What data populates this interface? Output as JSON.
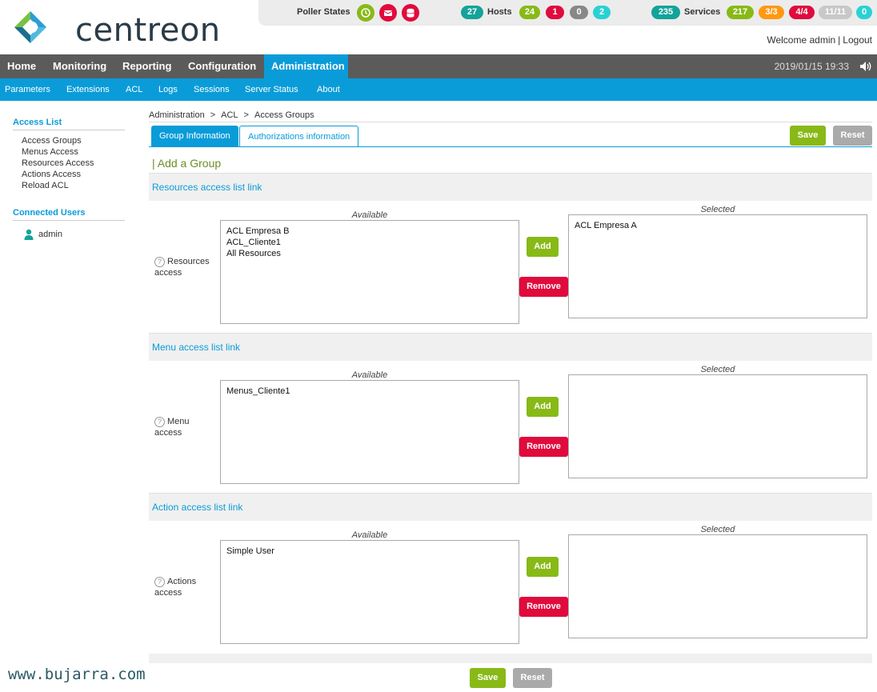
{
  "brand": {
    "name": "centreon"
  },
  "top": {
    "poller_states_label": "Poller States",
    "hosts_label": "Hosts",
    "hosts": [
      "27",
      "24",
      "1",
      "0",
      "2"
    ],
    "services_label": "Services",
    "services": [
      "235",
      "217",
      "3/3",
      "4/4",
      "11/11",
      "0"
    ],
    "welcome": "Welcome admin",
    "logout": "Logout",
    "colors": {
      "teal": "#13a39a",
      "green": "#88b917",
      "red": "#e00b3d",
      "gray": "#888888",
      "cyan": "#2ad1d4",
      "orange": "#ff9913",
      "lightgray": "#c8c8c8"
    }
  },
  "nav": {
    "items": [
      "Home",
      "Monitoring",
      "Reporting",
      "Configuration",
      "Administration"
    ],
    "active": "Administration",
    "datetime": "2019/01/15 19:33"
  },
  "subnav": {
    "items": [
      "Parameters",
      "Extensions",
      "ACL",
      "Logs",
      "Sessions",
      "Server Status",
      "About"
    ]
  },
  "sidebar": {
    "access_list_title": "Access List",
    "links": [
      "Access Groups",
      "Menus Access",
      "Resources Access",
      "Actions Access",
      "Reload ACL"
    ],
    "connected_title": "Connected Users",
    "users": [
      "admin"
    ]
  },
  "breadcrumb": [
    "Administration",
    "ACL",
    "Access Groups"
  ],
  "tabs": [
    "Group Information",
    "Authorizations information"
  ],
  "buttons": {
    "save": "Save",
    "reset": "Reset",
    "add": "Add",
    "remove": "Remove"
  },
  "form_title": "| Add a Group",
  "captions": {
    "available": "Available",
    "selected": "Selected"
  },
  "sections": [
    {
      "header": "Resources access list link",
      "label": "Resources access",
      "available": [
        "ACL Empresa B",
        "ACL_Cliente1",
        "All Resources"
      ],
      "selected": [
        "ACL Empresa A"
      ]
    },
    {
      "header": "Menu access list link",
      "label": "Menu access",
      "available": [
        "Menus_Cliente1"
      ],
      "selected": []
    },
    {
      "header": "Action access list link",
      "label": "Actions access",
      "available": [
        "Simple User"
      ],
      "selected": []
    }
  ],
  "watermark": "www.bujarra.com"
}
